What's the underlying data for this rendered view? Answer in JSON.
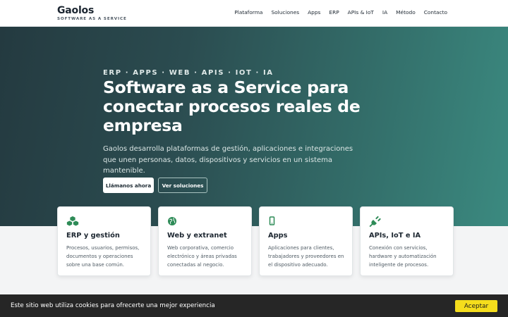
{
  "header": {
    "brand": "Gaolos",
    "tagline": "SOFTWARE AS A SERVICE",
    "nav": [
      "Plataforma",
      "Soluciones",
      "Apps",
      "ERP",
      "APIs & IoT",
      "IA",
      "Método",
      "Contacto"
    ]
  },
  "hero": {
    "eyebrow": "ERP · APPS · WEB · APIS · IOT · IA",
    "title": "Software as a Service para conectar procesos reales de empresa",
    "description": "Gaolos desarrolla plataformas de gestión, aplicaciones e integraciones que unen personas, datos, dispositivos y servicios en un sistema mantenible.",
    "primary_button": "Llámanos ahora",
    "secondary_button": "Ver soluciones"
  },
  "cards": [
    {
      "icon": "cubes-icon",
      "title": "ERP y gestión",
      "text": "Procesos, usuarios, permisos, documentos y operaciones sobre una base común."
    },
    {
      "icon": "globe-icon",
      "title": "Web y extranet",
      "text": "Web corporativa, comercio electrónico y áreas privadas conectadas al negocio."
    },
    {
      "icon": "mobile-icon",
      "title": "Apps",
      "text": "Aplicaciones para clientes, trabajadores y proveedores en el dispositivo adecuado."
    },
    {
      "icon": "plug-icon",
      "title": "APIs, IoT e IA",
      "text": "Conexión con servicios, hardware y automatización inteligente de procesos."
    }
  ],
  "cookie": {
    "text": "Este sitio web utiliza cookies para ofrecerte una mejor experiencia",
    "button": "Aceptar"
  },
  "colors": {
    "accent": "#2e8b57",
    "cookie_button": "#f5dd1c",
    "hero_start": "#243a40",
    "hero_end": "#3b8a80"
  }
}
